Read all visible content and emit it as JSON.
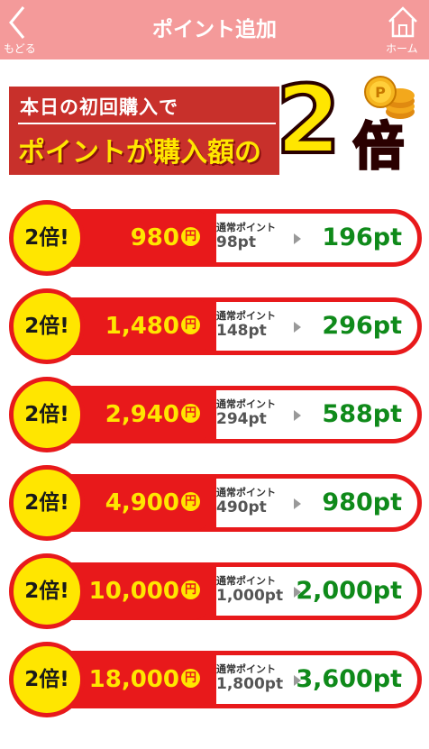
{
  "header": {
    "title": "ポイント追加",
    "back_label": "もどる",
    "home_label": "ホーム",
    "bg_color": "#f49a9a"
  },
  "banner": {
    "line1": "本日の初回購入で",
    "line2": "ポイントが購入額の",
    "big_number": "2",
    "big_suffix": "倍",
    "coin_mark": "P"
  },
  "offers": [
    {
      "badge": "2倍!",
      "price": "980",
      "yen": "円",
      "normal_label": "通常ポイント",
      "normal_pt": "98pt",
      "bonus_pt": "196pt"
    },
    {
      "badge": "2倍!",
      "price": "1,480",
      "yen": "円",
      "normal_label": "通常ポイント",
      "normal_pt": "148pt",
      "bonus_pt": "296pt"
    },
    {
      "badge": "2倍!",
      "price": "2,940",
      "yen": "円",
      "normal_label": "通常ポイント",
      "normal_pt": "294pt",
      "bonus_pt": "588pt"
    },
    {
      "badge": "2倍!",
      "price": "4,900",
      "yen": "円",
      "normal_label": "通常ポイント",
      "normal_pt": "490pt",
      "bonus_pt": "980pt"
    },
    {
      "badge": "2倍!",
      "price": "10,000",
      "yen": "円",
      "normal_label": "通常ポイント",
      "normal_pt": "1,000pt",
      "bonus_pt": "2,000pt"
    },
    {
      "badge": "2倍!",
      "price": "18,000",
      "yen": "円",
      "normal_label": "通常ポイント",
      "normal_pt": "1,800pt",
      "bonus_pt": "3,600pt"
    }
  ],
  "colors": {
    "accent_red": "#e8191b",
    "badge_yellow": "#ffe600",
    "bonus_green": "#0f8a1a"
  }
}
